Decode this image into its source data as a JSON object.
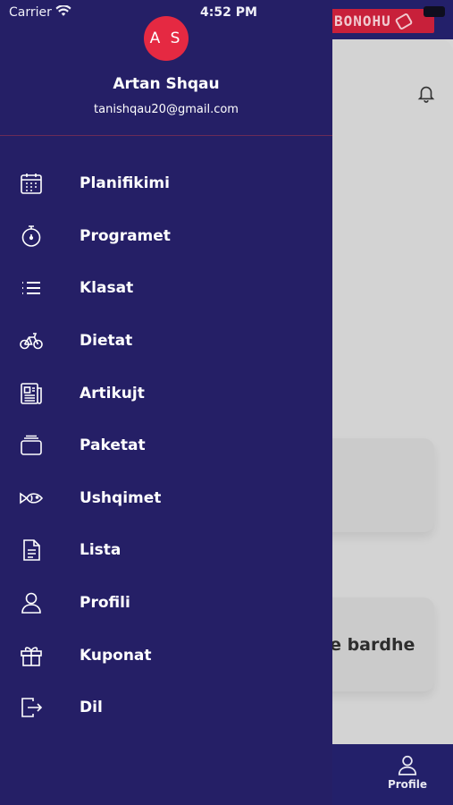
{
  "status_bar": {
    "carrier": "Carrier",
    "time": "4:52 PM"
  },
  "drawer": {
    "avatar_initials": "A S",
    "user_name": "Artan Shqau",
    "user_email": "tanishqau20@gmail.com",
    "items": [
      {
        "label": "Planifikimi",
        "icon": "calendar-icon"
      },
      {
        "label": "Programet",
        "icon": "stopwatch-icon"
      },
      {
        "label": "Klasat",
        "icon": "list-icon"
      },
      {
        "label": "Dietat",
        "icon": "bicycle-icon"
      },
      {
        "label": "Artikujt",
        "icon": "newspaper-icon"
      },
      {
        "label": "Paketat",
        "icon": "package-icon"
      },
      {
        "label": "Ushqimet",
        "icon": "fish-icon"
      },
      {
        "label": "Lista",
        "icon": "document-icon"
      },
      {
        "label": "Profili",
        "icon": "user-icon"
      },
      {
        "label": "Kuponat",
        "icon": "gift-icon"
      },
      {
        "label": "Dil",
        "icon": "logout-icon"
      }
    ]
  },
  "background": {
    "bonus_label": "BONOHU",
    "card_text": "te bardhe",
    "tab_profile_label": "Profile"
  },
  "colors": {
    "drawer_bg": "#251f66",
    "accent_red": "#e52942",
    "text_white": "#ffffff"
  }
}
